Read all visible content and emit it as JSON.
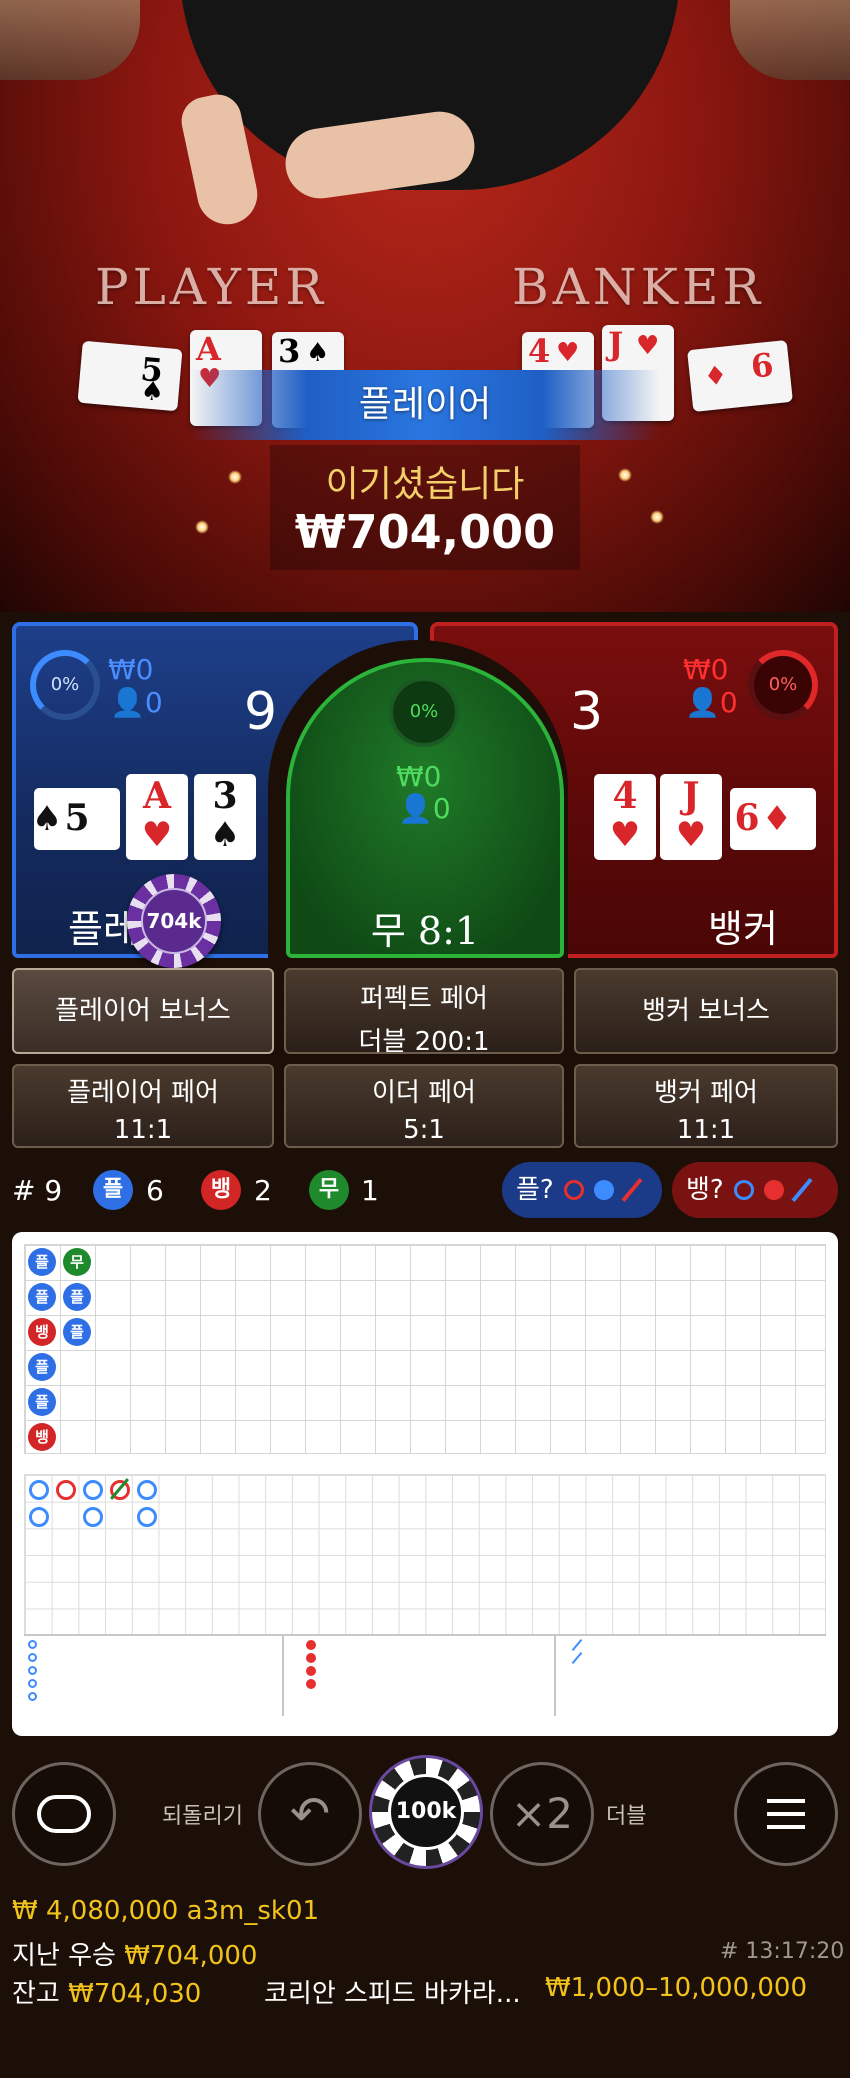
{
  "table": {
    "player_label": "PLAYER",
    "banker_label": "BANKER",
    "player_cards": [
      {
        "rank": "5",
        "suit": "♠",
        "red": false
      },
      {
        "rank": "A",
        "suit": "♥",
        "red": true
      },
      {
        "rank": "3",
        "suit": "♠",
        "red": false
      }
    ],
    "banker_cards": [
      {
        "rank": "4",
        "suit": "♥",
        "red": true
      },
      {
        "rank": "J",
        "suit": "♥",
        "red": true
      },
      {
        "rank": "6",
        "suit": "♦",
        "red": true
      }
    ]
  },
  "result": {
    "winner_label": "플레이어",
    "win_message": "이기셨습니다",
    "win_amount": "₩704,000"
  },
  "player_spot": {
    "percent": "0%",
    "amount": "₩0",
    "players": "0",
    "score": "9",
    "label": "플레이어",
    "chip": "704k"
  },
  "tie_spot": {
    "percent": "0%",
    "amount": "₩0",
    "players": "0",
    "label": "무 8:1"
  },
  "banker_spot": {
    "percent": "0%",
    "amount": "₩0",
    "players": "0",
    "score": "3",
    "label": "뱅커"
  },
  "side_bets": {
    "player_bonus": "플레이어 보너스",
    "perfect_pair": "퍼펙트 페어",
    "perfect_pair_odds": "더블 200:1",
    "banker_bonus": "뱅커 보너스",
    "player_pair": "플레이어 페어",
    "player_pair_odds": "11:1",
    "either_pair": "이더 페어",
    "either_pair_odds": "5:1",
    "banker_pair": "뱅커 페어",
    "banker_pair_odds": "11:1"
  },
  "stats": {
    "round_prefix": "#",
    "round": "9",
    "player_badge": "플",
    "player_count": "6",
    "banker_badge": "뱅",
    "banker_count": "2",
    "tie_badge": "무",
    "tie_count": "1",
    "player_predict": "플?",
    "banker_predict": "뱅?"
  },
  "roadmap": {
    "bead_letters": {
      "P": "플",
      "B": "뱅",
      "T": "무"
    }
  },
  "controls": {
    "undo_label": "되돌리기",
    "chip_value": "100k",
    "double_symbol": "×2",
    "double_label": "더블"
  },
  "footer": {
    "total_bet": "₩ 4,080,000",
    "username": "a3m_sk01",
    "last_win_label": "지난 우승",
    "last_win_amount": "₩704,000",
    "round_id": "# 13:17:20",
    "balance_label": "잔고",
    "balance_amount": "₩704,030",
    "game_name": "코리안 스피드 바카라...",
    "limits": "₩1,000–10,000,000"
  },
  "colors": {
    "player_blue": "#2f6fe6",
    "banker_red": "#c02020",
    "tie_green": "#2bb33a",
    "gold": "#f2c31b"
  }
}
